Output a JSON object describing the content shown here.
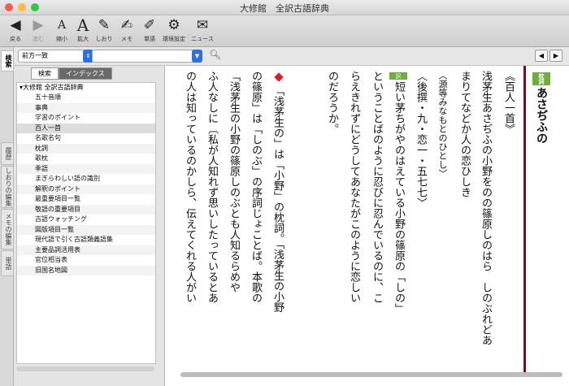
{
  "window": {
    "title": "大修館　全訳古語辞典"
  },
  "toolbar": {
    "back": "戻る",
    "forward": "進む",
    "shrink": "縮小",
    "enlarge": "拡大",
    "bookmark": "しおり",
    "memo": "メモ",
    "wordbook": "単語",
    "settings": "環境設定",
    "news": "ニュース"
  },
  "side_tabs": [
    "検索",
    "履歴",
    "しおりの編集",
    "メモの編集",
    "単語"
  ],
  "search": {
    "mode": "前方一致",
    "query": ""
  },
  "left_tabs": {
    "search": "検索",
    "index": "インデックス"
  },
  "tree": {
    "root": "大修館 全訳古語辞典",
    "items": [
      "五十音順",
      "事典",
      "学習のポイント",
      "百人一首",
      "名歌名句",
      "枕詞",
      "歌枕",
      "季語",
      "まぎらわしい語の識別",
      "解釈のポイント",
      "最重要項目一覧",
      "敬語の重要項目",
      "古語ウォッチング",
      "図版項目一覧",
      "現代語で引く古語類義語集",
      "主要品詞活用表",
      "官位相当表",
      "旧国名地図"
    ],
    "selected_index": 3
  },
  "entry": {
    "headword": "あさぢふの",
    "badge": "枕詞",
    "section": "《百人一首》",
    "poem1": "浅茅生あさぢふの小野をのの篠原しのはら　しのぶれどあ",
    "poem2": "まりてなどか人の恋ひしき",
    "author": "〈源等みなもとのひとし〉",
    "source": "〈後撰・九・恋一・五七七〉",
    "trans_tag": "訳",
    "trans1": "短い茅ちがやのはえている小野の篠原の「しの」",
    "trans2": "ということばのように忍びに忍んでいるのに、こ",
    "trans3": "らえきれずにどうしてあなたがこのように恋しい",
    "trans4": "のだろうか。",
    "note1": "「浅茅生の」は「小野」の枕詞。「浅茅生の小野",
    "note2": "の篠原」は「しのぶ」の序詞じょことば。本歌の",
    "note3": "「浅茅生の小野の篠原しのぶとも人知るらめや",
    "note4": "ふ人なしに〔私が人知れず思いしたっているとあ",
    "note5": "の人は知っているのかしら、伝えてくれる人がい"
  },
  "colors": {
    "accent_bar": "#7a0c1c",
    "badge_green": "#6fae3d",
    "marker_red": "#e01b1b",
    "selector_blue": "#2f6fe0"
  }
}
